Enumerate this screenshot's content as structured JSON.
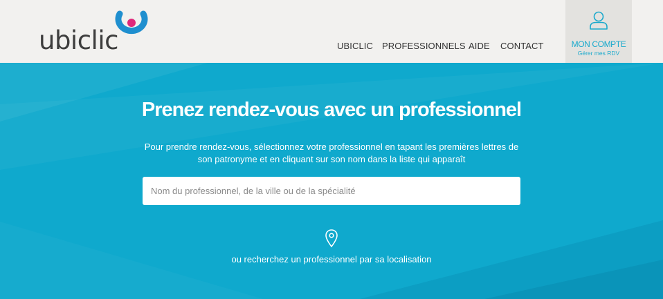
{
  "brand": {
    "name": "ubiclic",
    "colors": {
      "primary": "#0fa9cd",
      "logo_blue": "#1f8fcf",
      "logo_pink": "#e0287a",
      "header_bg": "#f2f1ef"
    }
  },
  "nav": {
    "items": [
      {
        "label": "UBICLIC"
      },
      {
        "label": "PROFESSIONNELS"
      },
      {
        "label": "AIDE"
      },
      {
        "label": "CONTACT"
      }
    ]
  },
  "account": {
    "icon": "user-icon",
    "title": "MON COMPTE",
    "subtitle": "Gérer mes RDV"
  },
  "hero": {
    "title": "Prenez rendez-vous avec un professionnel",
    "description": "Pour prendre rendez-vous, sélectionnez votre professionnel en tapant les premières lettres de son patronyme et en cliquant sur son nom dans la liste qui apparaît",
    "search_placeholder": "Nom du professionnel, de la ville ou de la spécialité",
    "search_value": "",
    "location_icon": "map-pin-icon",
    "location_link": "ou recherchez un professionnel par sa localisation"
  }
}
